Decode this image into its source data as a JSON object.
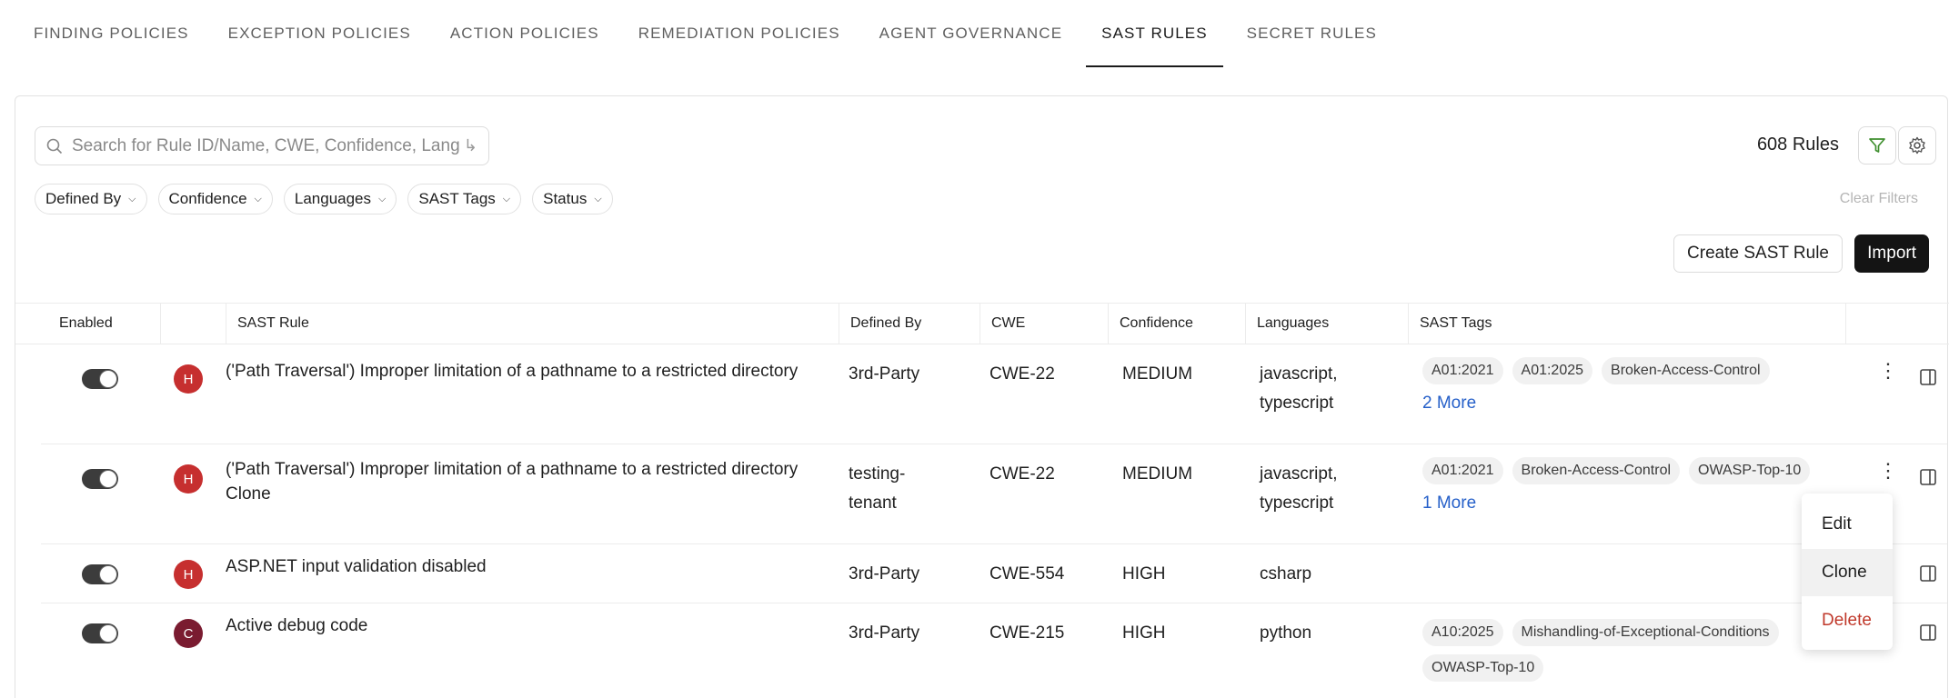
{
  "tabs": [
    {
      "label": "FINDING POLICIES"
    },
    {
      "label": "EXCEPTION POLICIES"
    },
    {
      "label": "ACTION POLICIES"
    },
    {
      "label": "REMEDIATION POLICIES"
    },
    {
      "label": "AGENT GOVERNANCE"
    },
    {
      "label": "SAST RULES",
      "active": true
    },
    {
      "label": "SECRET RULES"
    }
  ],
  "search": {
    "placeholder": "Search for Rule ID/Name, CWE, Confidence, Languages"
  },
  "rule_count": "608 Rules",
  "filters": [
    {
      "label": "Defined By"
    },
    {
      "label": "Confidence"
    },
    {
      "label": "Languages"
    },
    {
      "label": "SAST Tags"
    },
    {
      "label": "Status"
    }
  ],
  "clear_filters": "Clear Filters",
  "actions": {
    "create": "Create SAST Rule",
    "import": "Import"
  },
  "columns": {
    "enabled": "Enabled",
    "rule": "SAST Rule",
    "defined_by": "Defined By",
    "cwe": "CWE",
    "confidence": "Confidence",
    "languages": "Languages",
    "tags": "SAST Tags"
  },
  "rows": [
    {
      "enabled": true,
      "severity": "H",
      "rule_line1": "('Path Traversal') Improper limitation of a pathname to a restricted directory",
      "rule_line2": "",
      "defined_by_line1": "3rd-Party",
      "defined_by_line2": "",
      "cwe": "CWE-22",
      "confidence": "MEDIUM",
      "lang_line1": "javascript,",
      "lang_line2": "typescript",
      "tags": [
        "A01:2021",
        "A01:2025",
        "Broken-Access-Control"
      ],
      "more": "2 More"
    },
    {
      "enabled": true,
      "severity": "H",
      "rule_line1": "('Path Traversal') Improper limitation of a pathname to a restricted directory",
      "rule_line2": "Clone",
      "defined_by_line1": "testing-",
      "defined_by_line2": "tenant",
      "cwe": "CWE-22",
      "confidence": "MEDIUM",
      "lang_line1": "javascript,",
      "lang_line2": "typescript",
      "tags": [
        "A01:2021",
        "Broken-Access-Control",
        "OWASP-Top-10"
      ],
      "more": "1 More"
    },
    {
      "enabled": true,
      "severity": "H",
      "rule_line1": "ASP.NET input validation disabled",
      "rule_line2": "",
      "defined_by_line1": "3rd-Party",
      "defined_by_line2": "",
      "cwe": "CWE-554",
      "confidence": "HIGH",
      "lang_line1": "csharp",
      "lang_line2": "",
      "tags": [],
      "more": ""
    },
    {
      "enabled": true,
      "severity": "C",
      "rule_line1": "Active debug code",
      "rule_line2": "",
      "defined_by_line1": "3rd-Party",
      "defined_by_line2": "",
      "cwe": "CWE-215",
      "confidence": "HIGH",
      "lang_line1": "python",
      "lang_line2": "",
      "tags": [
        "A10:2025",
        "Mishandling-of-Exceptional-Conditions"
      ],
      "tags_line2": [
        "OWASP-Top-10"
      ],
      "more": ""
    }
  ],
  "context_menu": {
    "edit": "Edit",
    "clone": "Clone",
    "delete": "Delete"
  },
  "colors": {
    "high": "#c62f2f",
    "critical": "#7a1b30",
    "link": "#2660c9",
    "filter_icon": "#3f8f2f",
    "danger": "#c0392b"
  },
  "icons": [
    "search-icon",
    "enter-icon",
    "filter-icon",
    "gear-icon",
    "chevron-down-icon",
    "kebab-icon",
    "side-panel-icon"
  ]
}
